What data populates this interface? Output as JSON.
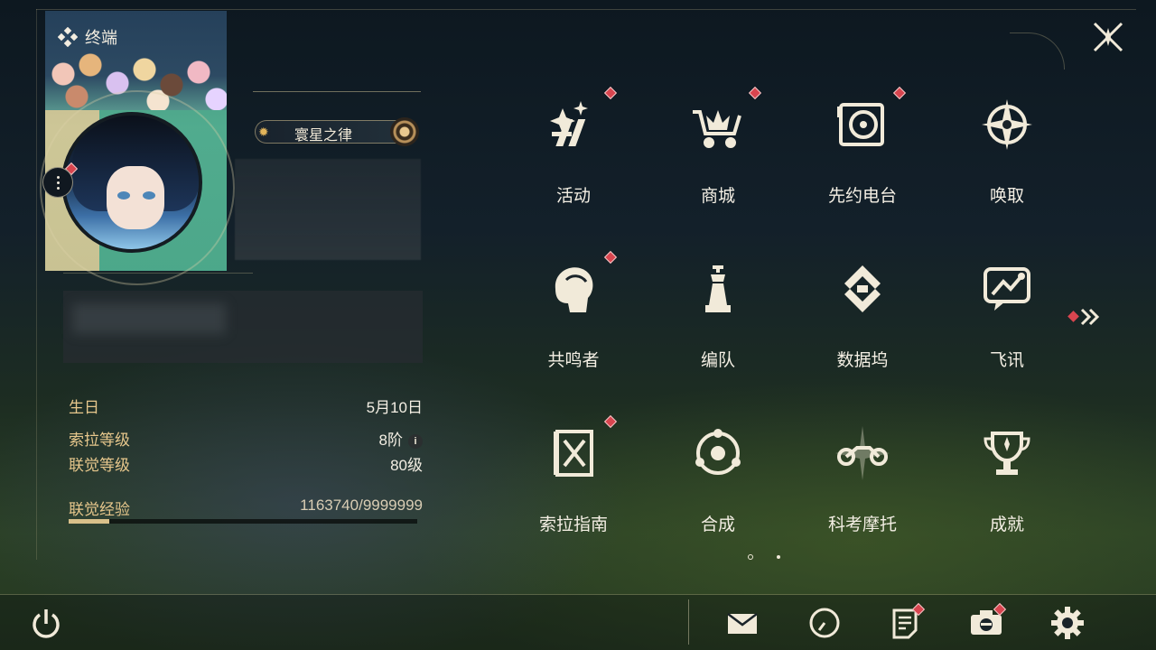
{
  "header": {
    "title": "终端"
  },
  "profile": {
    "title_badge": "寰星之律",
    "stats": [
      {
        "label": "生日",
        "value": "5月10日"
      },
      {
        "label": "索拉等级",
        "value": "8阶"
      },
      {
        "label": "联觉等级",
        "value": "80级"
      },
      {
        "label": "联觉经验",
        "value": "1163740/9999999"
      }
    ],
    "exp_fraction": 0.116
  },
  "menu": {
    "items": [
      {
        "label": "活动",
        "icon": "sparkle-icon",
        "badge": true
      },
      {
        "label": "商城",
        "icon": "shopping-cart-icon",
        "badge": true
      },
      {
        "label": "先约电台",
        "icon": "radio-icon",
        "badge": true
      },
      {
        "label": "唤取",
        "icon": "compass-star-icon",
        "badge": false
      },
      {
        "label": "共鸣者",
        "icon": "character-profile-icon",
        "badge": true
      },
      {
        "label": "编队",
        "icon": "chess-piece-icon",
        "badge": false
      },
      {
        "label": "数据坞",
        "icon": "data-dock-icon",
        "badge": false
      },
      {
        "label": "飞讯",
        "icon": "message-bubble-icon",
        "badge": false
      },
      {
        "label": "索拉指南",
        "icon": "guide-book-icon",
        "badge": true
      },
      {
        "label": "合成",
        "icon": "synthesis-icon",
        "badge": false
      },
      {
        "label": "科考摩托",
        "icon": "motorbike-icon",
        "badge": false
      },
      {
        "label": "成就",
        "icon": "trophy-icon",
        "badge": false
      }
    ],
    "page_count": 2,
    "current_page": 1
  },
  "bottom": {
    "icons": [
      "mail-icon",
      "clock-icon",
      "notice-icon",
      "camera-icon",
      "settings-gear-icon"
    ]
  },
  "colors": {
    "accent_gold": "#e7c78c",
    "badge_red": "#d8454f",
    "text_light": "#f4efe4"
  }
}
